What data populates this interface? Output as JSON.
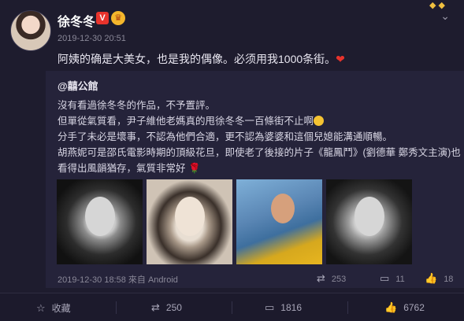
{
  "post": {
    "author": "徐冬冬",
    "badge_v": "V",
    "badge_crown": "♛",
    "time": "2019-12-30 20:51",
    "text": "阿姨的确是大美女，也是我的偶像。必须用我1000条街。",
    "heart": "❤"
  },
  "repost": {
    "author": "@囍公館",
    "lines": [
      "沒有看過徐冬冬的作品，不予置評。",
      "但單從氣質看，尹子維他老媽真的甩徐冬冬一百條街不止啊",
      "分手了未必是壞事，不認為他們合適，更不認為婆婆和這個兒媳能溝通順暢。",
      "胡燕妮可是邵氏電影時期的頂級花旦，即使老了後接的片子《龍鳳鬥》(劉德華 鄭秀文主演)也",
      "看得出風韻猶存，氣質非常好"
    ],
    "rose": "🌹",
    "footer": "2019-12-30 18:58 來自 Android",
    "reposts": "253",
    "comments": "11",
    "likes": "18"
  },
  "bottom_bar": {
    "favorite": "收藏",
    "repost_count": "250",
    "comment_count": "1816",
    "like_count": "6762"
  },
  "icons": {
    "favorite": "star-icon",
    "repost": "repost-icon",
    "comment": "comment-icon",
    "like": "thumb-up-icon",
    "menu": "chevron-down-icon"
  }
}
